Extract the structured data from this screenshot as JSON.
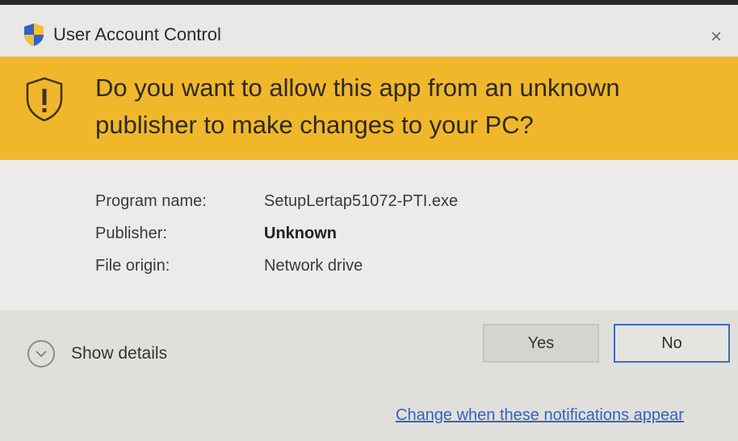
{
  "window": {
    "title": "User Account Control",
    "close_glyph": "×",
    "icon": "uac-shield-icon"
  },
  "banner": {
    "question": "Do you want to allow this app from an unknown publisher to make changes to your PC?",
    "icon": "warning-shield-icon",
    "color": "#f1b72a"
  },
  "info": {
    "program_label": "Program name:",
    "program_value": "SetupLertap51072-PTI.exe",
    "publisher_label": "Publisher:",
    "publisher_value": "Unknown",
    "origin_label": "File origin:",
    "origin_value": "Network drive"
  },
  "footer": {
    "details_label": "Show details",
    "details_icon": "chevron-down-icon",
    "yes_label": "Yes",
    "no_label": "No",
    "link_text": "Change when these notifications appear"
  },
  "colors": {
    "link": "#2f66c4",
    "focus_border": "#3c6dc3"
  }
}
